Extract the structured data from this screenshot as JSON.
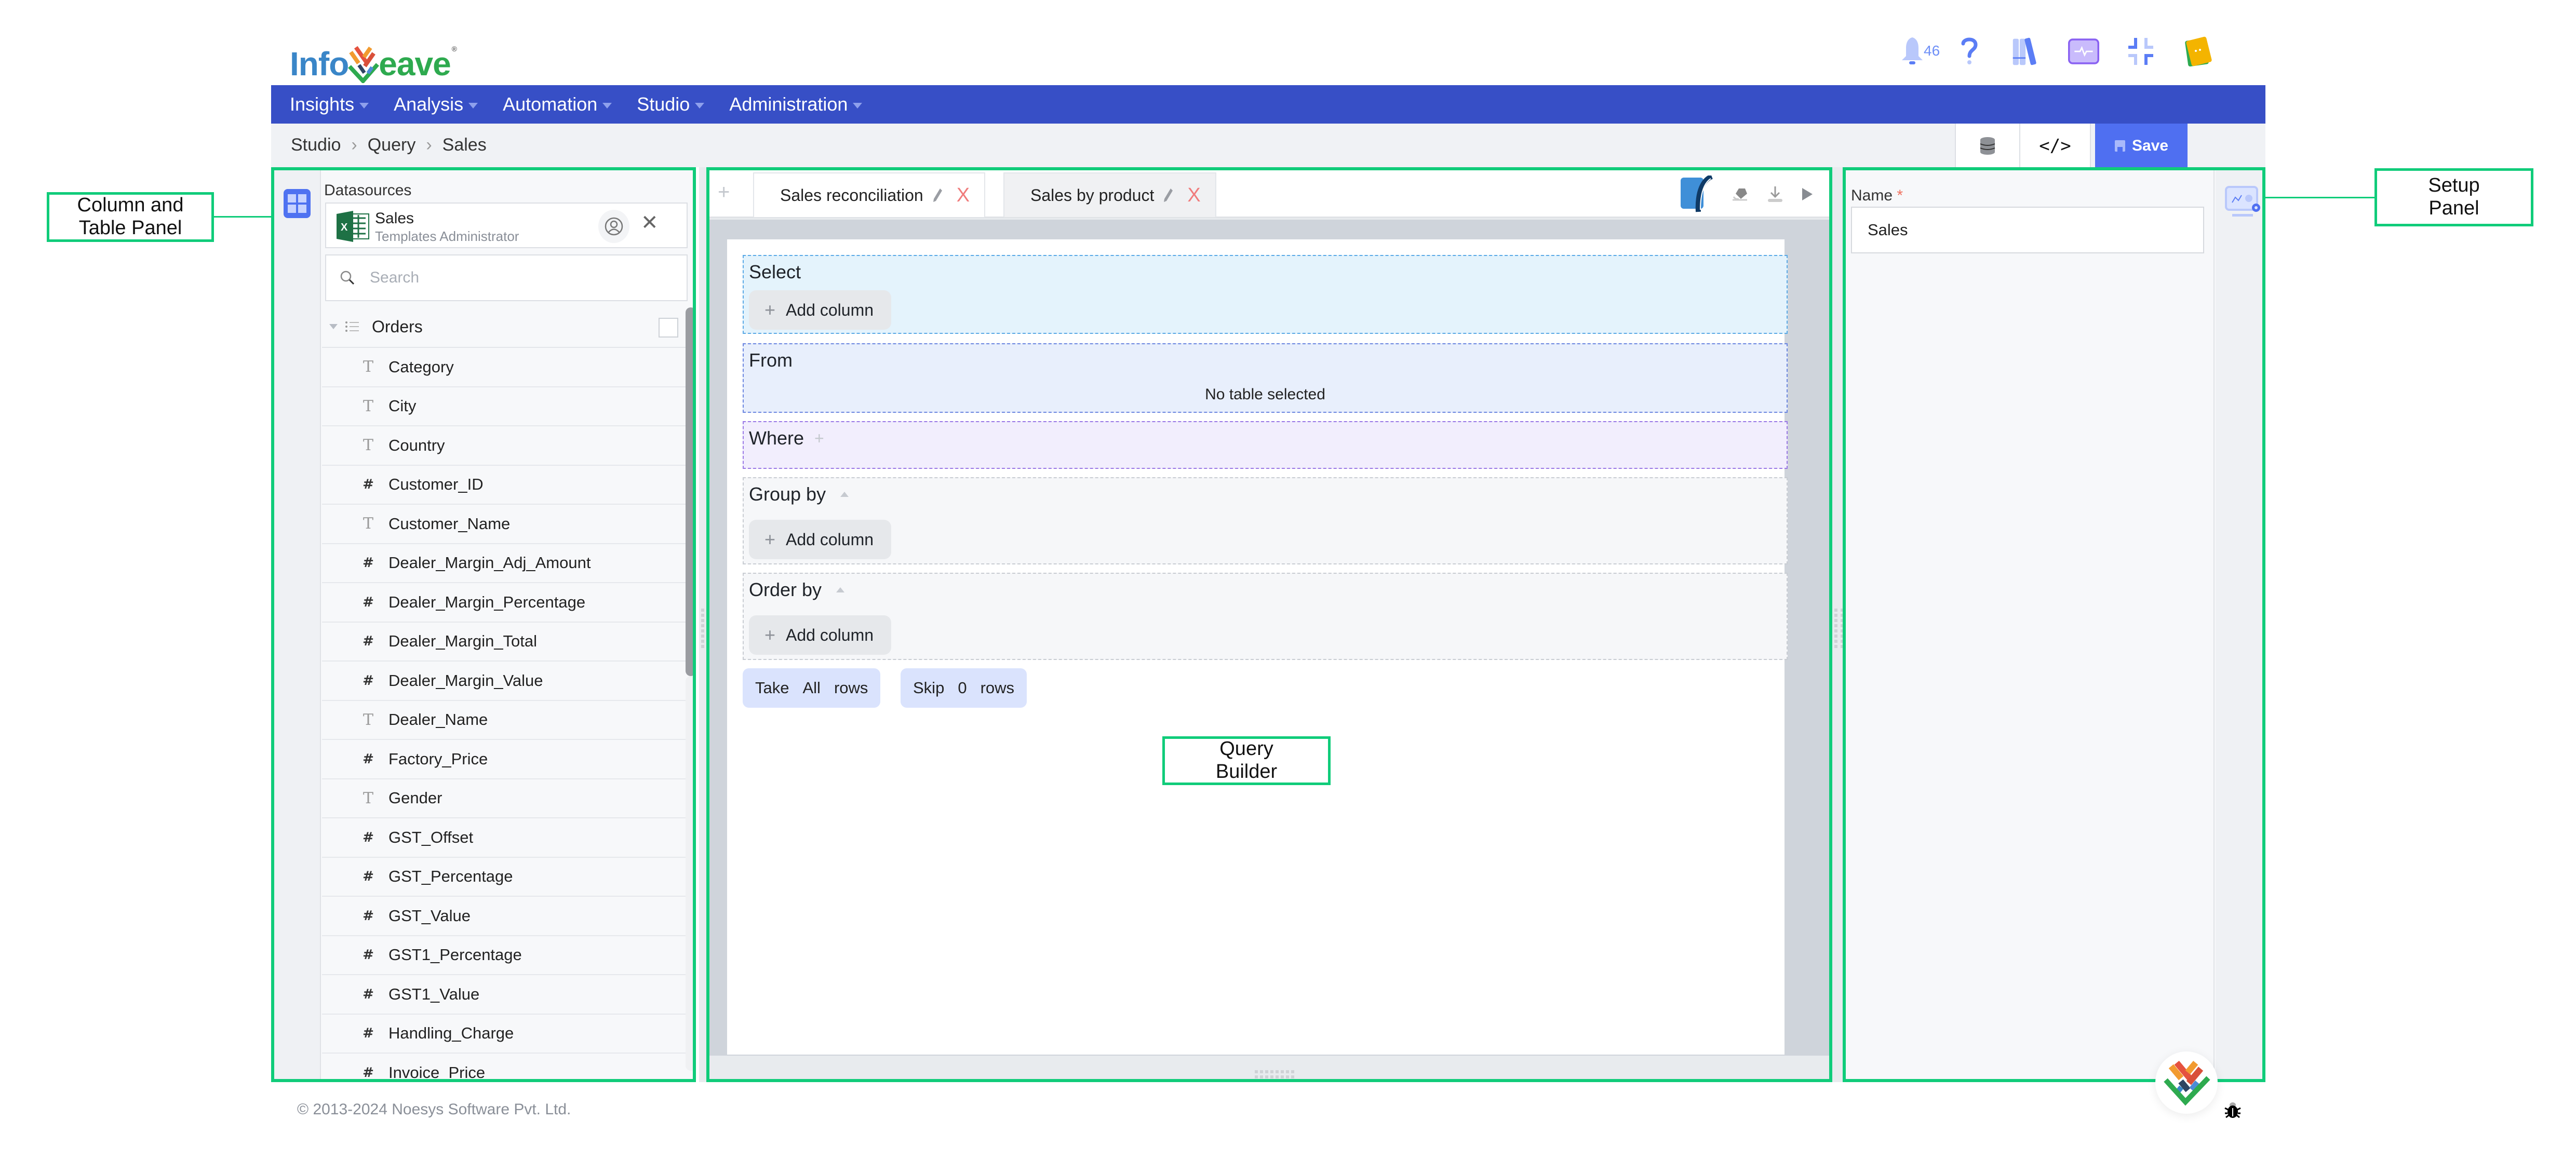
{
  "header": {
    "logo_text_left": "Info",
    "logo_text_right": "eave",
    "notification_count": "46",
    "icons": [
      "bell-icon",
      "help-icon",
      "library-icon",
      "monitor-pulse-icon",
      "collapse-icon",
      "user-avatar-icon"
    ]
  },
  "nav": {
    "items": [
      {
        "label": "Insights"
      },
      {
        "label": "Analysis"
      },
      {
        "label": "Automation"
      },
      {
        "label": "Studio"
      },
      {
        "label": "Administration"
      }
    ]
  },
  "breadcrumb": [
    "Studio",
    "Query",
    "Sales"
  ],
  "left_panel": {
    "datasources_label": "Datasources",
    "datasource": {
      "name": "Sales",
      "owner": "Templates Administrator",
      "icon": "excel-icon"
    },
    "search_placeholder": "Search",
    "search_value": "",
    "table": {
      "name": "Orders",
      "expanded": true,
      "checked": false
    },
    "columns": [
      {
        "name": "Category",
        "type": "text"
      },
      {
        "name": "City",
        "type": "text"
      },
      {
        "name": "Country",
        "type": "text"
      },
      {
        "name": "Customer_ID",
        "type": "number"
      },
      {
        "name": "Customer_Name",
        "type": "text"
      },
      {
        "name": "Dealer_Margin_Adj_Amount",
        "type": "number"
      },
      {
        "name": "Dealer_Margin_Percentage",
        "type": "number"
      },
      {
        "name": "Dealer_Margin_Total",
        "type": "number"
      },
      {
        "name": "Dealer_Margin_Value",
        "type": "number"
      },
      {
        "name": "Dealer_Name",
        "type": "text"
      },
      {
        "name": "Factory_Price",
        "type": "number"
      },
      {
        "name": "Gender",
        "type": "text"
      },
      {
        "name": "GST_Offset",
        "type": "number"
      },
      {
        "name": "GST_Percentage",
        "type": "number"
      },
      {
        "name": "GST_Value",
        "type": "number"
      },
      {
        "name": "GST1_Percentage",
        "type": "number"
      },
      {
        "name": "GST1_Value",
        "type": "number"
      },
      {
        "name": "Handling_Charge",
        "type": "number"
      },
      {
        "name": "Invoice_Price",
        "type": "number"
      }
    ],
    "type_glyphs": {
      "text": "T",
      "number": "#"
    }
  },
  "query_builder": {
    "tabs": [
      {
        "label": "Sales reconciliation",
        "active": true
      },
      {
        "label": "Sales by product",
        "active": false
      }
    ],
    "tab_close_glyph": "X",
    "tools": [
      "sql-editor-icon",
      "eraser-icon",
      "download-icon",
      "run-icon"
    ],
    "select": {
      "title": "Select",
      "add_label": "Add column"
    },
    "from": {
      "title": "From",
      "empty_text": "No table selected"
    },
    "where": {
      "title": "Where"
    },
    "group_by": {
      "title": "Group by",
      "add_label": "Add column"
    },
    "order_by": {
      "title": "Order by",
      "add_label": "Add column"
    },
    "take": {
      "prefix": "Take",
      "value": "All",
      "suffix": "rows"
    },
    "skip": {
      "prefix": "Skip",
      "value": "0",
      "suffix": "rows"
    }
  },
  "setup_panel": {
    "toolbar": {
      "save_label": "Save"
    },
    "name_label": "Name",
    "required_mark": "*",
    "name_value": "Sales"
  },
  "annotations": {
    "left": "Column and\nTable Panel",
    "center": "Query\nBuilder",
    "right": "Setup\nPanel"
  },
  "footer": {
    "copyright": "© 2013-2024 Noesys Software Pvt. Ltd."
  },
  "colors": {
    "nav_bg": "#374fc6",
    "accent_blue": "#4f6ff1",
    "annotation_green": "#10cc7a",
    "close_red": "#f07c7c"
  }
}
